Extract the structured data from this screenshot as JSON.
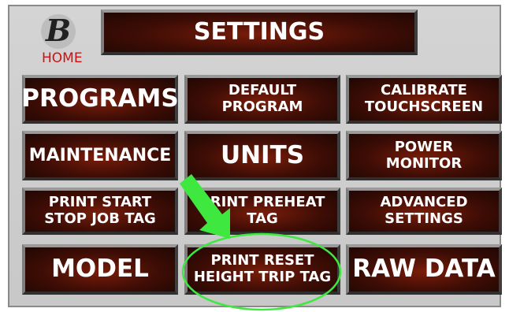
{
  "header": {
    "title": "SETTINGS",
    "home_label": "HOME",
    "logo_letter": "B"
  },
  "buttons": {
    "programs": "PROGRAMS",
    "default_program": "DEFAULT\nPROGRAM",
    "calibrate_touchscreen": "CALIBRATE\nTOUCHSCREEN",
    "maintenance": "MAINTENANCE",
    "units": "UNITS",
    "power_monitor": "POWER\nMONITOR",
    "print_start_stop": "PRINT START\nSTOP JOB TAG",
    "print_preheat": "PRINT PREHEAT\nTAG",
    "advanced_settings": "ADVANCED\nSETTINGS",
    "model": "MODEL",
    "print_reset_height": "PRINT RESET\nHEIGHT TRIP TAG",
    "raw_data": "RAW DATA"
  },
  "annotations": {
    "arrow_color": "#3ee83e",
    "highlight_color": "#3ee83e"
  },
  "colors": {
    "button_fill": "#4a1005",
    "panel_bg": "#cccccc",
    "home_text": "#d01010"
  }
}
